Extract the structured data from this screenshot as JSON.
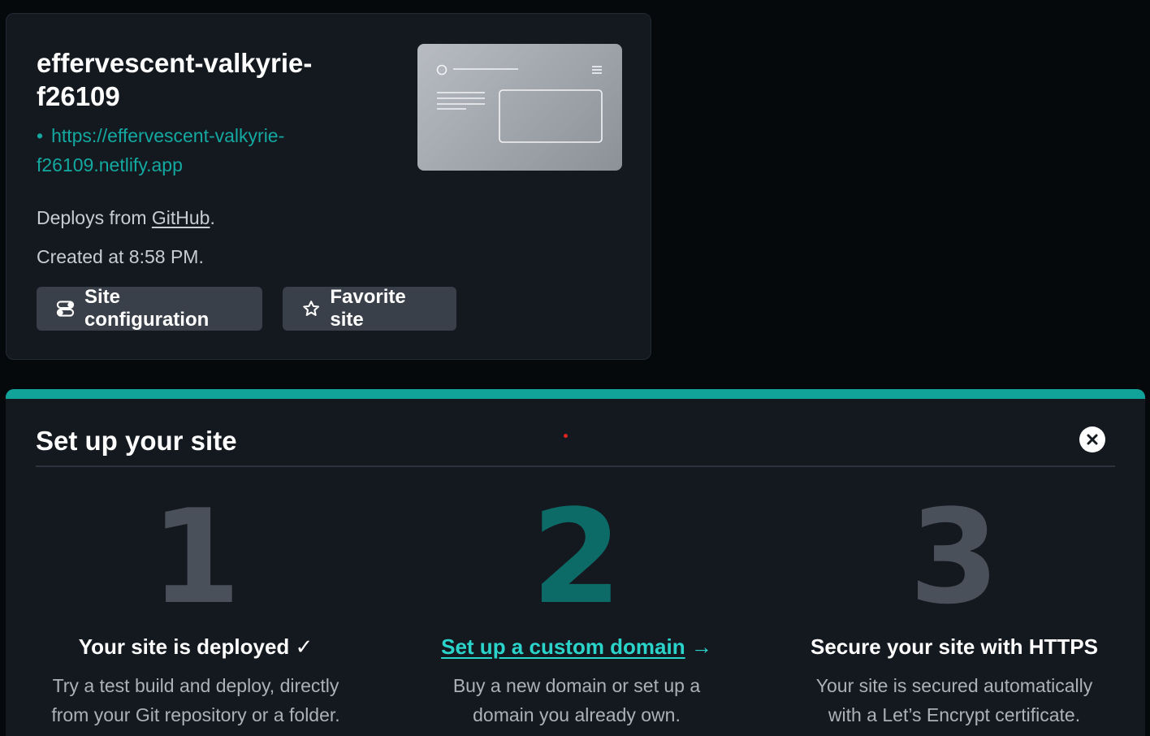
{
  "site": {
    "name": "effervescent-valkyrie-f26109",
    "url": "https://effervescent-valkyrie-f26109.netlify.app",
    "url_bullet": "•",
    "deploy_prefix": "Deploys from ",
    "deploy_source": "GitHub",
    "deploy_suffix": ".",
    "created": "Created at 8:58 PM.",
    "buttons": {
      "config_label": "Site configuration",
      "config_icon": "toggles-icon",
      "favorite_label": "Favorite site",
      "favorite_icon": "star-outline-icon"
    }
  },
  "setup": {
    "title": "Set up your site",
    "close_icon": "close-circle-icon",
    "steps": [
      {
        "number": "1",
        "heading": "Your site is deployed ✓",
        "description": "Try a test build and deploy, directly from your Git repository or a folder."
      },
      {
        "number": "2",
        "heading": "Set up a custom domain",
        "arrow": "→",
        "description": "Buy a new domain or set up a domain you already own."
      },
      {
        "number": "3",
        "heading": "Secure your site with HTTPS",
        "description": "Your site is secured automatically with a Let’s Encrypt certificate."
      }
    ]
  },
  "colors": {
    "background": "#06090c",
    "card": "#141920",
    "accent": "#11a29a",
    "link": "#13a8a0",
    "link_bright": "#2ad4cb",
    "button": "#3a4049"
  }
}
